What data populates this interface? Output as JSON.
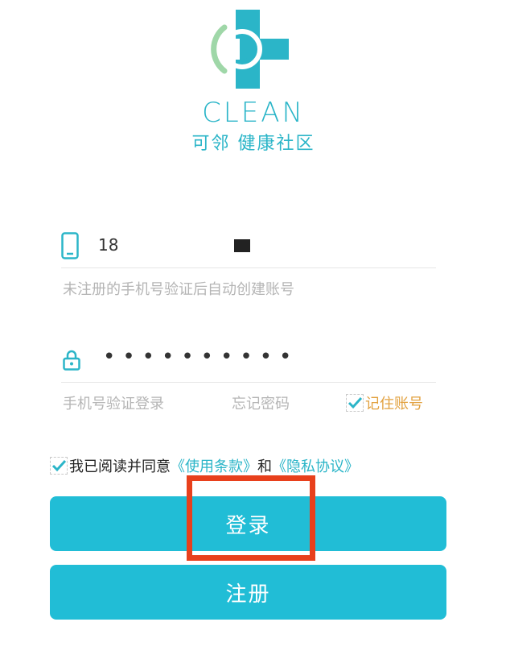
{
  "brand": {
    "name": "CLEAN",
    "subtitle": "可邻 健康社区"
  },
  "login_form": {
    "phone_value": "18",
    "phone_hint": "未注册的手机号验证后自动创建账号",
    "password_dots": "••••••••••",
    "sms_login_label": "手机号验证登录",
    "forgot_password_label": "忘记密码",
    "remember_account_label": "记住账号",
    "remember_account_checked": true
  },
  "agreement": {
    "checked": true,
    "prefix": "我已阅读并同意",
    "terms_link": "《使用条款》",
    "and": "和",
    "privacy_link": "《隐私协议》"
  },
  "buttons": {
    "login": "登录",
    "register": "注册"
  },
  "colors": {
    "brand_teal": "#21bdd6",
    "remember_orange": "#e2a13f",
    "highlight_red": "#e8401c"
  }
}
